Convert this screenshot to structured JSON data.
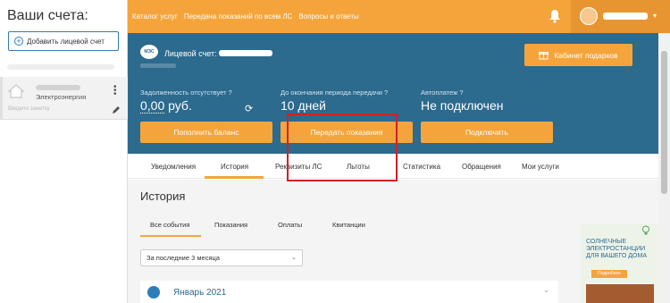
{
  "sidebar": {
    "title": "Ваши счета:",
    "add_button": "Добавить лицевой счет",
    "account": {
      "provider": "Электроэнергия",
      "hint": "Введите заметку"
    }
  },
  "topnav": {
    "links": [
      "Каталог услуг",
      "Передача показаний по всем ЛС",
      "Вопросы и ответы"
    ]
  },
  "account_header": {
    "logo_text": "МЭС",
    "account_label": "Лицевой счет:",
    "gift_button": "Кабинет подарков"
  },
  "summary": {
    "debt_label": "Задолженность отсутствует",
    "debt_value": "0,00",
    "debt_currency": "руб.",
    "period_label": "До окончания периода передачи",
    "period_value": "10 дней",
    "autopay_label": "Автоплатеж",
    "autopay_value": "Не подключен"
  },
  "actions": {
    "pay": "Пополнить баланс",
    "submit_readings": "Передать показания",
    "connect": "Подключить"
  },
  "tabs": [
    "Уведомления",
    "История",
    "Реквизиты ЛС",
    "Льготы",
    "Статистика",
    "Обращения",
    "Мои услуги"
  ],
  "active_tab": "История",
  "history": {
    "title": "История",
    "subtabs": [
      "Все события",
      "Показания",
      "Оплаты",
      "Квитанции"
    ],
    "period": "За последние 3 месяца",
    "month": "Январь 2021"
  },
  "ad": {
    "text": "СОЛНЕЧНЫЕ ЭЛЕКТРОСТАНЦИИ ДЛЯ ВАШЕГО ДОМА",
    "button": "Подробнее"
  },
  "colors": {
    "accent": "#f5a43b",
    "header_bg": "#2c6a8e",
    "annotation": "#d32027"
  }
}
